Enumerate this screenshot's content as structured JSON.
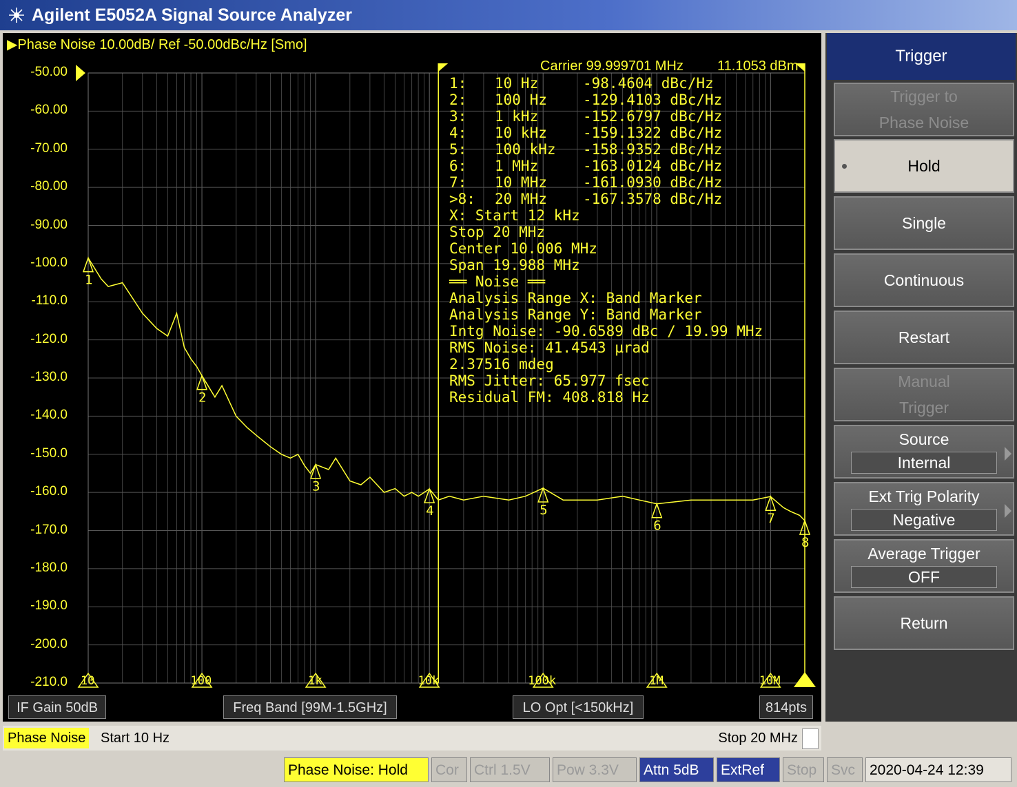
{
  "app": {
    "title": "Agilent E5052A Signal Source Analyzer"
  },
  "trace": {
    "header": "Phase Noise 10.00dB/ Ref -50.00dBc/Hz [Smo]"
  },
  "carrier": {
    "label": "Carrier 99.999701 MHz",
    "power": "11.1053 dBm"
  },
  "y_ticks": [
    "-50.00",
    "-60.00",
    "-70.00",
    "-80.00",
    "-90.00",
    "-100.0",
    "-110.0",
    "-120.0",
    "-130.0",
    "-140.0",
    "-150.0",
    "-160.0",
    "-170.0",
    "-180.0",
    "-190.0",
    "-200.0",
    "-210.0"
  ],
  "x_ticks": [
    "10",
    "100",
    "1k",
    "10k",
    "100k",
    "1M",
    "10M"
  ],
  "markers": [
    {
      "id": "1",
      "prefix": " 1:",
      "freq": "10 Hz",
      "value": "-98.4604 dBc/Hz"
    },
    {
      "id": "2",
      "prefix": " 2:",
      "freq": "100 Hz",
      "value": "-129.4103 dBc/Hz"
    },
    {
      "id": "3",
      "prefix": " 3:",
      "freq": "1 kHz",
      "value": "-152.6797 dBc/Hz"
    },
    {
      "id": "4",
      "prefix": " 4:",
      "freq": "10 kHz",
      "value": "-159.1322 dBc/Hz"
    },
    {
      "id": "5",
      "prefix": " 5:",
      "freq": "100 kHz",
      "value": "-158.9352 dBc/Hz"
    },
    {
      "id": "6",
      "prefix": " 6:",
      "freq": "1 MHz",
      "value": "-163.0124 dBc/Hz"
    },
    {
      "id": "7",
      "prefix": " 7:",
      "freq": "10 MHz",
      "value": "-161.0930 dBc/Hz"
    },
    {
      "id": "8",
      "prefix": ">8:",
      "freq": "20 MHz",
      "value": "-167.3578 dBc/Hz"
    }
  ],
  "analysis_lines": [
    " X: Start 12 kHz",
    "     Stop 20 MHz",
    "   Center 10.006 MHz",
    "     Span 19.988 MHz",
    "══ Noise ══",
    "Analysis Range X: Band Marker",
    "Analysis Range Y: Band Marker",
    "Intg Noise: -90.6589 dBc / 19.99 MHz",
    " RMS Noise: 41.4543 µrad",
    "            2.37516 mdeg",
    "RMS Jitter: 65.977 fsec",
    "Residual FM: 408.818 Hz"
  ],
  "chart_data": {
    "type": "line",
    "x_scale": "log",
    "xlim": [
      10,
      20000000
    ],
    "ylim": [
      -210,
      -50
    ],
    "ylabel": "",
    "xlabel": "",
    "series": [
      {
        "x": [
          10,
          13,
          15,
          20,
          30,
          40,
          50,
          60,
          70,
          80,
          90,
          100,
          130,
          150,
          200,
          250,
          300,
          400,
          500,
          600,
          700,
          800,
          900,
          1000,
          1300,
          1500,
          2000,
          2500,
          3000,
          4000,
          5000,
          6000,
          7000,
          8000,
          9000,
          10000,
          12000,
          15000,
          20000,
          30000,
          50000,
          70000,
          100000,
          150000,
          200000,
          300000,
          500000,
          700000,
          1000000,
          2000000,
          3000000,
          5000000,
          7000000,
          10000000,
          13000000,
          15000000,
          18000000,
          20000000
        ],
        "y": [
          -98.5,
          -104,
          -106,
          -105,
          -113,
          -117,
          -119,
          -113,
          -122,
          -125,
          -127,
          -129.4,
          -135,
          -132,
          -140,
          -143,
          -145,
          -148,
          -150,
          -151,
          -150,
          -153,
          -155,
          -152.7,
          -154,
          -151,
          -157,
          -158,
          -156,
          -160,
          -159,
          -161,
          -160,
          -161,
          -160,
          -159.1,
          -162,
          -161,
          -162,
          -161,
          -162,
          -161,
          -158.9,
          -162,
          -162,
          -162,
          -161,
          -162,
          -163,
          -162,
          -162,
          -162,
          -162,
          -161.1,
          -164,
          -165,
          -166,
          -167.4
        ]
      }
    ],
    "band_marker_range": [
      "12 kHz",
      "20 MHz"
    ]
  },
  "info": {
    "if_gain": "IF Gain 50dB",
    "freq_band": "Freq Band [99M-1.5GHz]",
    "lo_opt": "LO Opt [<150kHz]",
    "points": "814pts"
  },
  "channel": {
    "name": "Phase Noise",
    "start": "Start 10 Hz",
    "stop": "Stop 20 MHz"
  },
  "status": {
    "meas": "Phase Noise: Hold",
    "cor": "Cor",
    "ctrl": "Ctrl  1.5V",
    "pow": "Pow  3.3V",
    "attn": "Attn 5dB",
    "extref": "ExtRef",
    "stop": "Stop",
    "svc": "Svc",
    "datetime": "2020-04-24 12:39"
  },
  "softkeys": {
    "title": "Trigger",
    "trigger_to": "Trigger to Phase Noise",
    "hold": "Hold",
    "single": "Single",
    "continuous": "Continuous",
    "restart": "Restart",
    "manual": "Manual Trigger",
    "source": "Source",
    "source_value": "Internal",
    "polarity": "Ext Trig Polarity",
    "polarity_value": "Negative",
    "avg_trigger": "Average Trigger",
    "avg_trigger_value": "OFF",
    "ret": "Return"
  },
  "colors": {
    "trace": "#ffff33",
    "screen": "#000000",
    "grid": "#555555",
    "softkey_header": "#1b2f73"
  }
}
